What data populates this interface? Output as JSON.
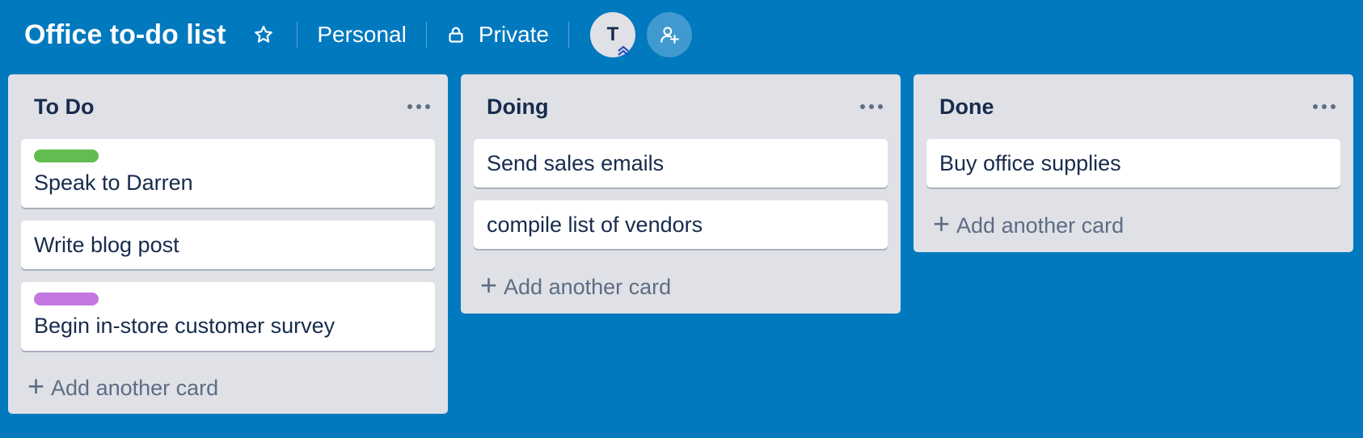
{
  "header": {
    "board_title": "Office to-do list",
    "star_icon": "star-outline-icon",
    "team_label": "Personal",
    "visibility_label": "Private",
    "visibility_icon": "lock-icon",
    "member_initial": "T",
    "invite_icon": "add-member-icon"
  },
  "colors": {
    "board_background": "#0079bf",
    "list_background": "#dfe1e6",
    "label_green": "#61bd4f",
    "label_purple": "#c377e0"
  },
  "lists": [
    {
      "title": "To Do",
      "cards": [
        {
          "text": "Speak to Darren",
          "label_color": "#61bd4f"
        },
        {
          "text": "Write blog post"
        },
        {
          "text": "Begin in-store customer survey",
          "label_color": "#c377e0"
        }
      ],
      "add_label": "Add another card"
    },
    {
      "title": "Doing",
      "cards": [
        {
          "text": "Send sales emails"
        },
        {
          "text": "compile list of vendors"
        }
      ],
      "add_label": "Add another card"
    },
    {
      "title": "Done",
      "cards": [
        {
          "text": "Buy office supplies"
        }
      ],
      "add_label": "Add another card"
    }
  ]
}
